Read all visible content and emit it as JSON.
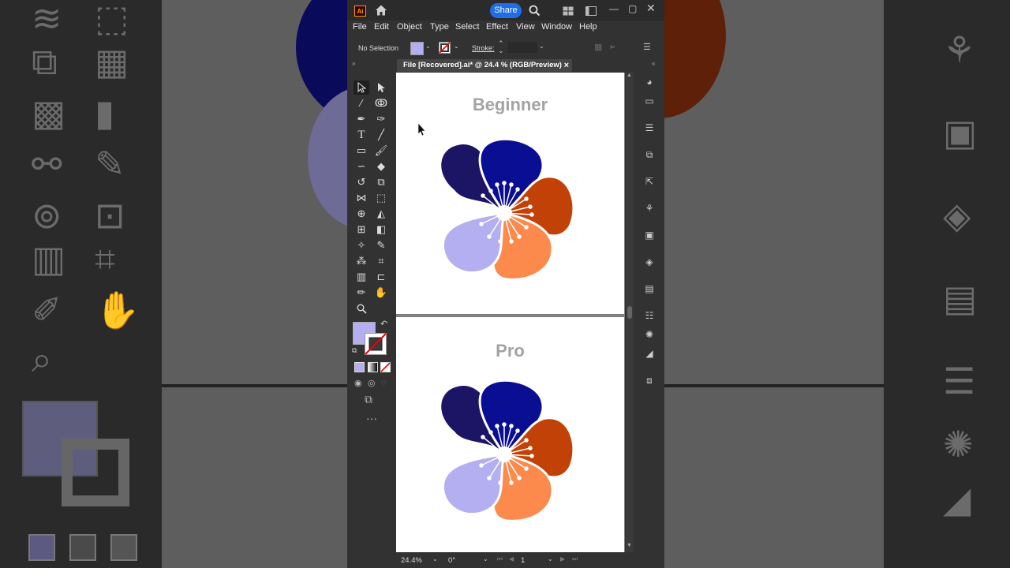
{
  "app": {
    "logo": "Ai"
  },
  "header": {
    "share_label": "Share"
  },
  "menu": [
    "File",
    "Edit",
    "Object",
    "Type",
    "Select",
    "Effect",
    "View",
    "Window",
    "Help"
  ],
  "control_bar": {
    "selection": "No Selection",
    "stroke_label": "Stroke:",
    "fill_color": "#b3aff0"
  },
  "document": {
    "tab_title": "File [Recovered].ai* @ 24.4 % (RGB/Preview)",
    "close": "×"
  },
  "artboards": [
    {
      "title": "Beginner"
    },
    {
      "title": "Pro"
    }
  ],
  "flower_colors": {
    "dark_navy": "#1c1566",
    "royal_blue": "#0a0e93",
    "burnt_orange": "#c24106",
    "light_orange": "#fb8a4c",
    "lavender": "#b3aff0"
  },
  "status_bar": {
    "zoom": "24.4%",
    "rotation": "0°",
    "artboard_number": "1"
  },
  "icons": [
    "home-icon",
    "search-icon",
    "selection-tool-icon",
    "direct-selection-tool-icon",
    "pen-tool-icon",
    "type-tool-icon",
    "line-tool-icon",
    "rectangle-tool-icon",
    "paintbrush-tool-icon",
    "rotate-tool-icon",
    "eraser-tool-icon",
    "eyedropper-tool-icon",
    "hand-tool-icon",
    "zoom-tool-icon",
    "graph-tool-icon",
    "gradient-tool-icon",
    "layers-icon",
    "properties-icon"
  ]
}
